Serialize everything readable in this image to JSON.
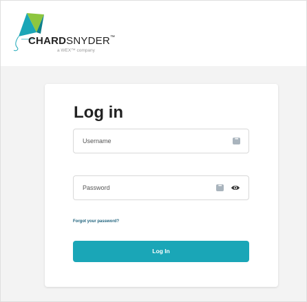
{
  "header": {
    "brand_bold": "CHARD",
    "brand_light": "SNYDER",
    "brand_tm": "™",
    "tagline": "a WEX™ company",
    "logo_icon": "kite-icon"
  },
  "login": {
    "title": "Log in",
    "username_placeholder": "Username",
    "password_placeholder": "Password",
    "forgot_label": "Forgot your password?",
    "submit_label": "Log In"
  },
  "colors": {
    "accent": "#1aa6b7",
    "link": "#1a5f7a",
    "background": "#f3f3f3"
  }
}
